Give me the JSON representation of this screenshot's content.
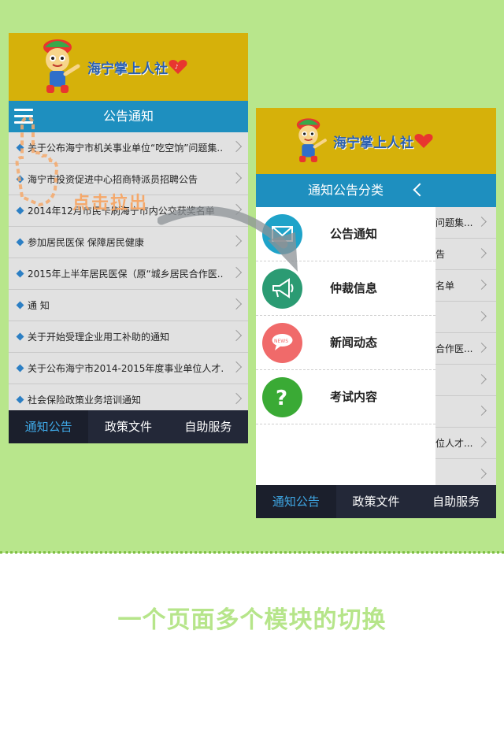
{
  "app": {
    "logo_text": "海宁掌上人社"
  },
  "left_screen": {
    "header_title": "公告通知",
    "list": [
      "关于公布海宁市机关事业单位“吃空饷”问题集...",
      "海宁市投资促进中心招商特派员招聘公告",
      "2014年12月市民卡刷海宁市内公交获奖名单",
      "参加居民医保 保障居民健康",
      "2015年上半年居民医保（原“城乡居民合作医...",
      "通 知",
      "关于开始受理企业用工补助的通知",
      "关于公布海宁市2014-2015年度事业单位人才...",
      "社会保险政策业务培训通知"
    ],
    "tabs": [
      "通知公告",
      "政策文件",
      "自助服务"
    ]
  },
  "right_screen": {
    "drawer_title": "通知公告分类",
    "drawer_items": [
      {
        "label": "公告通知",
        "icon": "mail-icon",
        "color": "#1fa3c9"
      },
      {
        "label": "仲裁信息",
        "icon": "megaphone-icon",
        "color": "#2b9b73"
      },
      {
        "label": "新闻动态",
        "icon": "news-bubble-icon",
        "color": "#f06a6a"
      },
      {
        "label": "考试内容",
        "icon": "question-icon",
        "color": "#3aaa35"
      }
    ],
    "peek_list": [
      "问题集...",
      "告",
      "名单",
      "",
      "合作医...",
      "",
      "",
      "位人才...",
      ""
    ],
    "tabs": [
      "通知公告",
      "政策文件",
      "自助服务"
    ]
  },
  "overlay_hint": "点击拉出",
  "caption": "一个页面多个模块的切换",
  "colors": {
    "page_bg": "#b8e68c",
    "banner": "#d6b10a",
    "header": "#1e8fbf",
    "tabbar": "#232838",
    "active_tab": "#3fa8e6"
  }
}
